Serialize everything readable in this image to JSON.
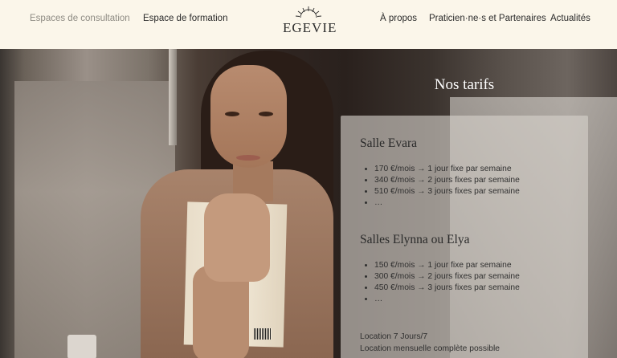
{
  "nav": {
    "left_items": [
      "Espaces de consultation",
      "Espace de formation"
    ],
    "logo_text": "EGEVIE",
    "right_items": [
      "À propos",
      "Praticien·ne·s et Partenaires",
      "Actualités"
    ]
  },
  "hero": {
    "title": "Nos tarifs",
    "sections": [
      {
        "heading": "Salle Evara",
        "items": [
          "170 €/mois → 1 jour fixe par semaine",
          "340 €/mois → 2 jours fixes par semaine",
          "510 €/mois → 3 jours fixes par semaine",
          "…"
        ]
      },
      {
        "heading": "Salles Elynna ou Elya",
        "items": [
          "150 €/mois → 1 jour fixe par semaine",
          "300 €/mois → 2 jours fixes par semaine",
          "450 €/mois → 3 jours fixes par semaine",
          "…"
        ]
      }
    ],
    "footer_lines": [
      "Location 7 Jours/7",
      "Location mensuelle complète possible"
    ]
  },
  "colors": {
    "nav_bg": "#fbf6ea",
    "nav_text": "#2b2b2b",
    "nav_active": "#8e8b83",
    "card_bg": "rgba(214,210,204,0.62)",
    "title_text": "#ffffff"
  },
  "icons": [
    "sun-rays-logo-icon"
  ]
}
